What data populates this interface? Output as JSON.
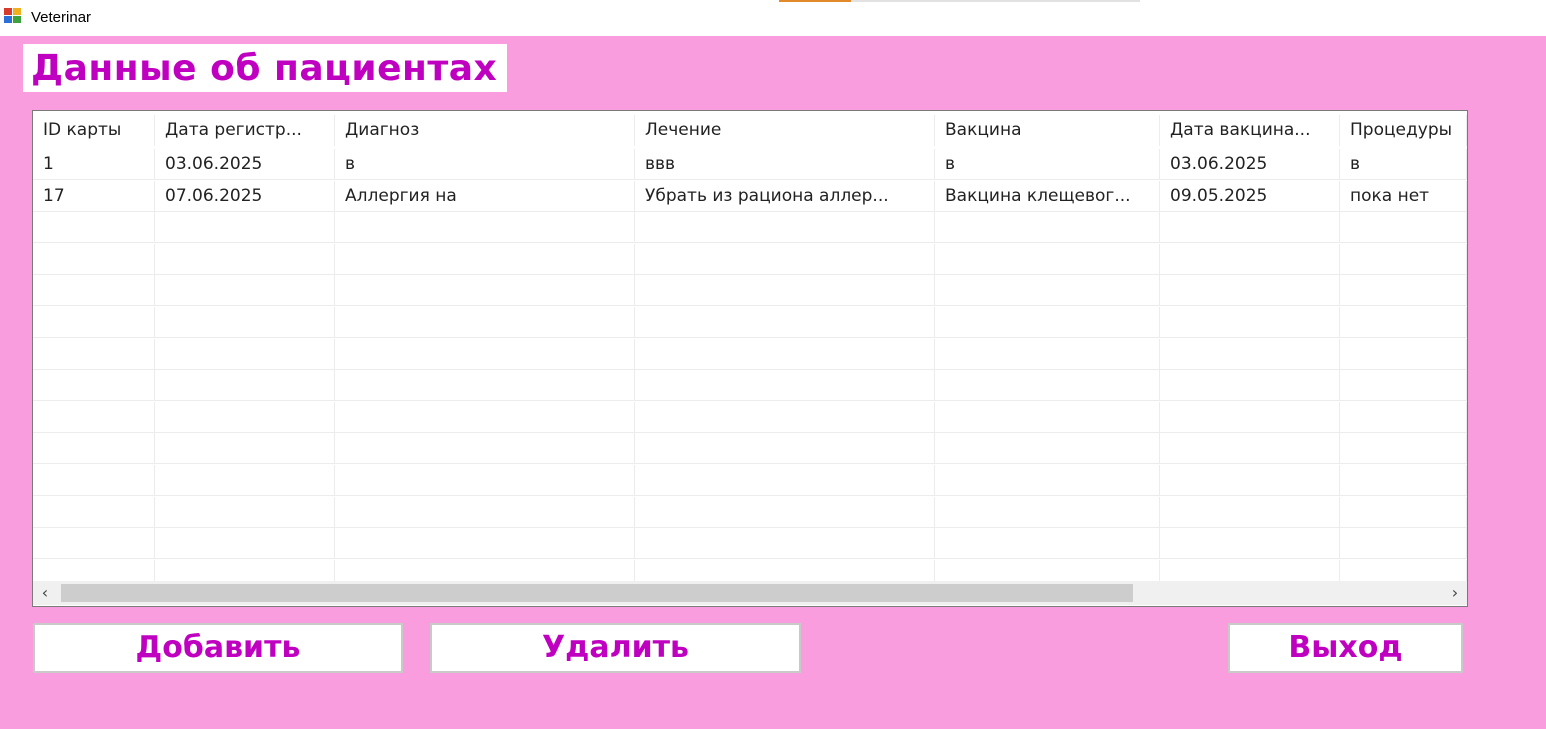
{
  "window": {
    "title": "Veterinar",
    "icon": "app-windows-icon"
  },
  "page": {
    "heading": "Данные об пациентах",
    "background_color": "#fa9ddf",
    "accent_color": "#c000c0"
  },
  "table": {
    "columns": [
      "ID карты",
      "Дата регистр...",
      "Диагноз",
      "Лечение",
      "Вакцина",
      "Дата вакцина...",
      "Процедуры"
    ],
    "rows": [
      [
        "1",
        "03.06.2025",
        "в",
        "ввв",
        "в",
        "03.06.2025",
        "в"
      ],
      [
        "17",
        "07.06.2025",
        "Аллергия на",
        "Убрать из рациона аллер...",
        "Вакцина клещевог...",
        "09.05.2025",
        "пока нет"
      ]
    ]
  },
  "scrollbar": {
    "left_arrow": "‹",
    "right_arrow": "›"
  },
  "buttons": {
    "add_label": "Добавить",
    "delete_label": "Удалить",
    "exit_label": "Выход"
  }
}
